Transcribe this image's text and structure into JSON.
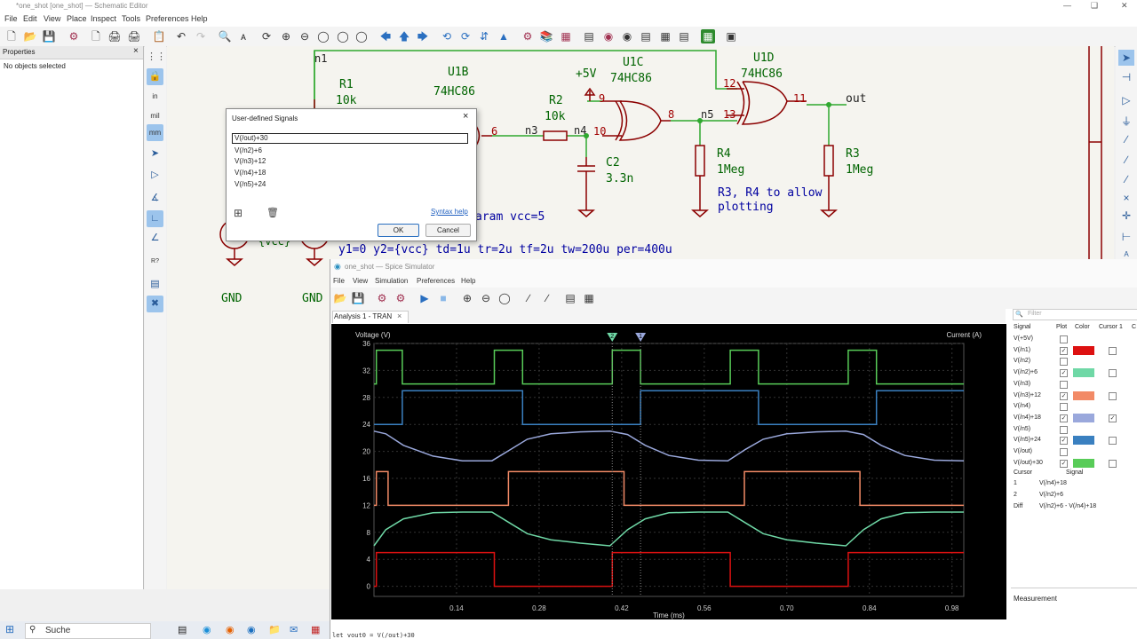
{
  "schematic_editor": {
    "title": "*one_shot [one_shot] — Schematic Editor",
    "menu": [
      "File",
      "Edit",
      "View",
      "Place",
      "Inspect",
      "Tools",
      "Preferences",
      "Help"
    ],
    "properties": {
      "header": "Properties",
      "status": "No objects selected"
    },
    "left_tools": [
      "grid",
      "lock",
      "in",
      "mil",
      "mm",
      "select",
      "bus",
      "plot",
      "net",
      "angle",
      "erc",
      "pin",
      "tool"
    ],
    "schematic": {
      "net_n1": "n1",
      "r1": {
        "ref": "R1",
        "value": "10k"
      },
      "u1b": {
        "ref": "U1B",
        "value": "74HC86"
      },
      "pin6": "6",
      "net_n3": "n3",
      "r2": {
        "ref": "R2",
        "value": "10k"
      },
      "net_n4": "n4",
      "pin10": "10",
      "pwr_5v": "+5V",
      "u1c": {
        "ref": "U1C",
        "value": "74HC86"
      },
      "pin9": "9",
      "pin8": "8",
      "net_n5": "n5",
      "pin13": "13",
      "pin12": "12",
      "u1d": {
        "ref": "U1D",
        "value": "74HC86"
      },
      "pin11": "11",
      "out": "out",
      "c2": {
        "ref": "C2",
        "value": "3.3n"
      },
      "r4": {
        "ref": "R4",
        "value": "1Meg"
      },
      "r3": {
        "ref": "R3",
        "value": "1Meg"
      },
      "note_line1": "R3, R4 to allow",
      "note_line2": "plotting",
      "param": "aram vcc=5",
      "vcc": "{vcc}",
      "gnd1": "GND",
      "gnd2": "GND",
      "pulse": "y1=0 y2={vcc} td=1u tr=2u tf=2u tw=200u per=400u"
    }
  },
  "dialog": {
    "title": "User-defined Signals",
    "signals": [
      "V(/out)+30",
      "V(/n2)+6",
      "V(/n3)+12",
      "V(/n4)+18",
      "V(/n5)+24"
    ],
    "syntax_help": "Syntax help",
    "ok": "OK",
    "cancel": "Cancel"
  },
  "simulator": {
    "title": "one_shot — Spice Simulator",
    "menu": [
      "File",
      "View",
      "Simulation",
      "Preferences",
      "Help"
    ],
    "tab": "Analysis 1 - TRAN",
    "filter_placeholder": "Filter",
    "signals_headers": {
      "signal": "Signal",
      "plot": "Plot",
      "color": "Color",
      "cursor1": "Cursor 1",
      "cursor2": "C"
    },
    "signals": [
      {
        "name": "V(+5V)",
        "plot": false,
        "color": null,
        "cursor": null
      },
      {
        "name": "V(/n1)",
        "plot": true,
        "color": "#dd1111",
        "cursor": false
      },
      {
        "name": "V(/n2)",
        "plot": false,
        "color": null,
        "cursor": null
      },
      {
        "name": "V(/n2)+6",
        "plot": true,
        "color": "#6fd8a6",
        "cursor": false
      },
      {
        "name": "V(/n3)",
        "plot": false,
        "color": null,
        "cursor": null
      },
      {
        "name": "V(/n3)+12",
        "plot": true,
        "color": "#f28a66",
        "cursor": false
      },
      {
        "name": "V(/n4)",
        "plot": false,
        "color": null,
        "cursor": null
      },
      {
        "name": "V(/n4)+18",
        "plot": true,
        "color": "#9aa8dc",
        "cursor": true
      },
      {
        "name": "V(/n5)",
        "plot": false,
        "color": null,
        "cursor": null
      },
      {
        "name": "V(/n5)+24",
        "plot": true,
        "color": "#3a80c0",
        "cursor": false
      },
      {
        "name": "V(/out)",
        "plot": false,
        "color": null,
        "cursor": null
      },
      {
        "name": "V(/out)+30",
        "plot": true,
        "color": "#58cc58",
        "cursor": false
      }
    ],
    "cursors_headers": {
      "cursor": "Cursor",
      "signal": "Signal"
    },
    "cursors": [
      {
        "id": "1",
        "signal": "V(/n4)+18"
      },
      {
        "id": "2",
        "signal": "V(/n2)+6"
      },
      {
        "id": "Diff",
        "signal": "V(/n2)+6 - V(/n4)+18"
      }
    ],
    "measurement": "Measurement",
    "console": "let vout0 = V(/out)+30"
  },
  "chart_data": {
    "type": "line",
    "ylabel": "Voltage (V)",
    "y2label": "Current (A)",
    "xlabel": "Time (ms)",
    "xlim": [
      0.0,
      1.0
    ],
    "ylim": [
      -1.5,
      36
    ],
    "xticks": [
      "0.14",
      "0.28",
      "0.42",
      "0.56",
      "0.70",
      "0.84",
      "0.98"
    ],
    "xtick_values": [
      0.14,
      0.28,
      0.42,
      0.56,
      0.7,
      0.84,
      0.98
    ],
    "yticks": [
      "0",
      "4",
      "8",
      "12",
      "16",
      "20",
      "24",
      "28",
      "32",
      "36"
    ],
    "ytick_values": [
      0,
      4,
      8,
      12,
      16,
      20,
      24,
      28,
      32,
      36
    ],
    "grid": true,
    "cursor_labels": [
      "2",
      "1"
    ],
    "cursors_x": [
      0.404,
      0.452
    ],
    "series": [
      {
        "name": "V(/out)+30",
        "color": "#58cc58",
        "x": [
          0.0,
          0.004,
          0.004,
          0.048,
          0.048,
          0.204,
          0.204,
          0.252,
          0.252,
          0.404,
          0.404,
          0.452,
          0.452,
          0.604,
          0.604,
          0.652,
          0.652,
          0.804,
          0.804,
          0.852,
          0.852,
          1.0
        ],
        "y": [
          30,
          30,
          35,
          35,
          30,
          30,
          35,
          35,
          30,
          30,
          35,
          35,
          30,
          30,
          35,
          35,
          30,
          30,
          35,
          35,
          30,
          30
        ]
      },
      {
        "name": "V(/n5)+24",
        "color": "#3a80c0",
        "x": [
          0.0,
          0.048,
          0.048,
          0.252,
          0.252,
          0.452,
          0.452,
          0.652,
          0.652,
          0.852,
          0.852,
          1.0
        ],
        "y": [
          24,
          24,
          29,
          29,
          24,
          24,
          29,
          29,
          24,
          24,
          29,
          29
        ]
      },
      {
        "name": "V(/n4)+18",
        "color": "#9aa8dc",
        "x": [
          0.0,
          0.02,
          0.05,
          0.1,
          0.15,
          0.2,
          0.23,
          0.26,
          0.3,
          0.35,
          0.4,
          0.43,
          0.46,
          0.5,
          0.55,
          0.6,
          0.63,
          0.66,
          0.7,
          0.75,
          0.8,
          0.83,
          0.86,
          0.9,
          0.95,
          1.0
        ],
        "y": [
          23,
          22.6,
          20.9,
          19.3,
          18.6,
          18.6,
          20.2,
          21.8,
          22.6,
          22.9,
          23,
          22.5,
          20.9,
          19.4,
          18.7,
          18.6,
          20.3,
          21.8,
          22.6,
          22.9,
          23,
          22.5,
          20.9,
          19.4,
          18.7,
          18.6
        ]
      },
      {
        "name": "V(/n3)+12",
        "color": "#f28a66",
        "x": [
          0.0,
          0.004,
          0.004,
          0.024,
          0.024,
          0.228,
          0.228,
          0.424,
          0.424,
          0.628,
          0.628,
          0.824,
          0.824,
          1.0
        ],
        "y": [
          12,
          12,
          17,
          17,
          12,
          12,
          17,
          17,
          12,
          12,
          17,
          17,
          12,
          12
        ]
      },
      {
        "name": "V(/n2)+6",
        "color": "#6fd8a6",
        "x": [
          0.0,
          0.02,
          0.05,
          0.1,
          0.15,
          0.2,
          0.23,
          0.26,
          0.3,
          0.35,
          0.4,
          0.43,
          0.46,
          0.5,
          0.55,
          0.6,
          0.63,
          0.66,
          0.7,
          0.75,
          0.8,
          0.83,
          0.86,
          0.9,
          0.95,
          1.0
        ],
        "y": [
          6,
          8.4,
          10,
          10.9,
          11,
          11,
          9.4,
          7.8,
          6.9,
          6.4,
          6,
          8.4,
          10,
          10.9,
          11,
          11,
          9.4,
          7.8,
          6.9,
          6.4,
          6,
          8.4,
          10,
          10.9,
          11,
          11
        ]
      },
      {
        "name": "V(/n1)",
        "color": "#dd1111",
        "x": [
          0.0,
          0.004,
          0.004,
          0.204,
          0.204,
          0.404,
          0.404,
          0.604,
          0.604,
          0.804,
          0.804,
          1.0
        ],
        "y": [
          0,
          0,
          5,
          5,
          0,
          0,
          5,
          5,
          0,
          0,
          5,
          5
        ]
      }
    ]
  }
}
